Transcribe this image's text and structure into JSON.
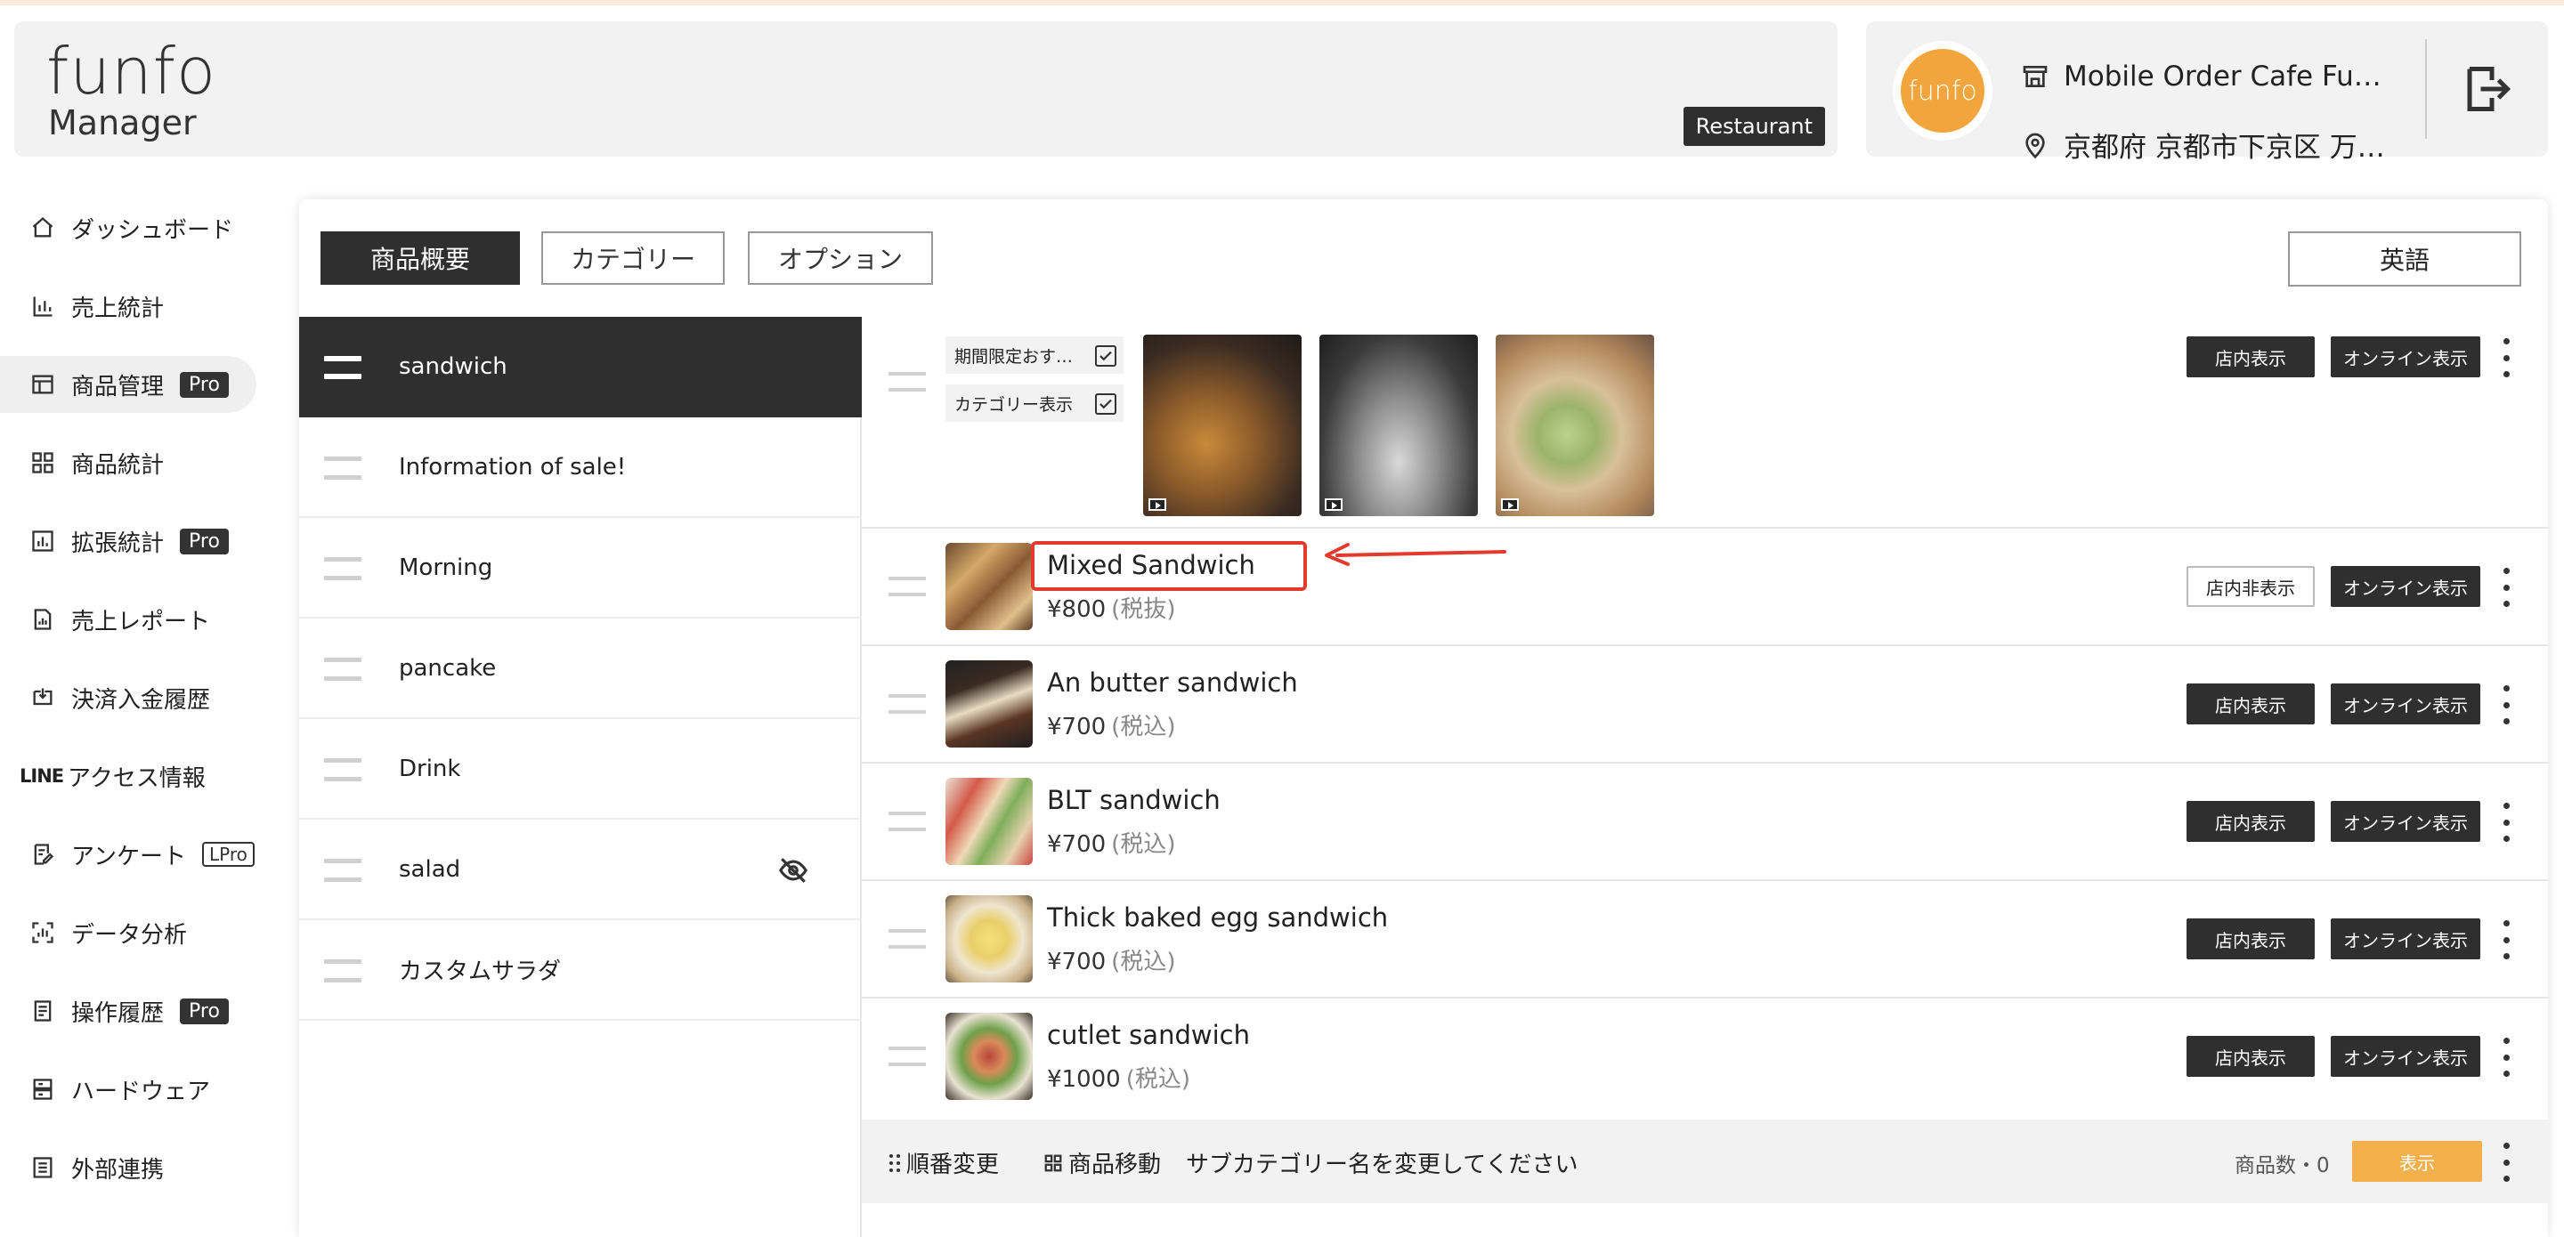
{
  "header": {
    "logo_top": "funfo",
    "logo_bottom": "Manager",
    "badge": "Restaurant",
    "store_avatar_text": "funfo",
    "store_name": "Mobile Order Cafe Fu…",
    "store_address": "京都府 京都市下京区 万…"
  },
  "sidebar": {
    "items": [
      {
        "label": "ダッシュボード",
        "icon": "home-icon"
      },
      {
        "label": "売上統計",
        "icon": "bar-chart-icon"
      },
      {
        "label": "商品管理",
        "icon": "layout-icon",
        "badge": "Pro",
        "active": true
      },
      {
        "label": "商品統計",
        "icon": "grid-icon"
      },
      {
        "label": "拡張統計",
        "icon": "chart-box-icon",
        "badge": "Pro"
      },
      {
        "label": "売上レポート",
        "icon": "report-icon"
      },
      {
        "label": "決済入金履歴",
        "icon": "payment-icon"
      },
      {
        "label": "アクセス情報",
        "icon": "line-icon",
        "prefix": "LINE"
      },
      {
        "label": "アンケート",
        "icon": "survey-icon",
        "badge": "LPro"
      },
      {
        "label": "データ分析",
        "icon": "analysis-icon"
      },
      {
        "label": "操作履歴",
        "icon": "history-icon",
        "badge": "Pro"
      },
      {
        "label": "ハードウェア",
        "icon": "hardware-icon"
      },
      {
        "label": "外部連携",
        "icon": "integration-icon"
      }
    ]
  },
  "tabs": [
    "商品概要",
    "カテゴリー",
    "オプション"
  ],
  "language_button": "英語",
  "categories": [
    {
      "label": "sandwich",
      "active": true
    },
    {
      "label": "Information of sale!"
    },
    {
      "label": "Morning"
    },
    {
      "label": "pancake"
    },
    {
      "label": "Drink"
    },
    {
      "label": "salad",
      "hidden": true
    },
    {
      "label": "カスタムサラダ"
    }
  ],
  "category_header": {
    "check1": "期間限定おす…",
    "check2": "カテゴリー表示",
    "btn_store": "店内表示",
    "btn_online": "オンライン表示"
  },
  "products": [
    {
      "name": "Mixed Sandwich",
      "price": "¥800",
      "tax": "(税抜)",
      "store_btn": "店内非表示",
      "online_btn": "オンライン表示"
    },
    {
      "name": "An butter sandwich",
      "price": "¥700",
      "tax": "(税込)",
      "store_btn": "店内表示",
      "online_btn": "オンライン表示"
    },
    {
      "name": "BLT sandwich",
      "price": "¥700",
      "tax": "(税込)",
      "store_btn": "店内表示",
      "online_btn": "オンライン表示"
    },
    {
      "name": "Thick baked egg sandwich",
      "price": "¥700",
      "tax": "(税込)",
      "store_btn": "店内表示",
      "online_btn": "オンライン表示"
    },
    {
      "name": "cutlet sandwich",
      "price": "¥1000",
      "tax": "(税込)",
      "store_btn": "店内表示",
      "online_btn": "オンライン表示"
    }
  ],
  "subcategory_bar": {
    "reorder": "順番変更",
    "move": "商品移動",
    "placeholder_name": "サブカテゴリー名を変更してください",
    "count": "商品数・0",
    "show_btn": "表示"
  },
  "colors": {
    "dark": "#2f2f2f",
    "accent_orange": "#f3b04d",
    "annotation_red": "#e23b2e",
    "avatar_orange": "#f2a53c"
  }
}
